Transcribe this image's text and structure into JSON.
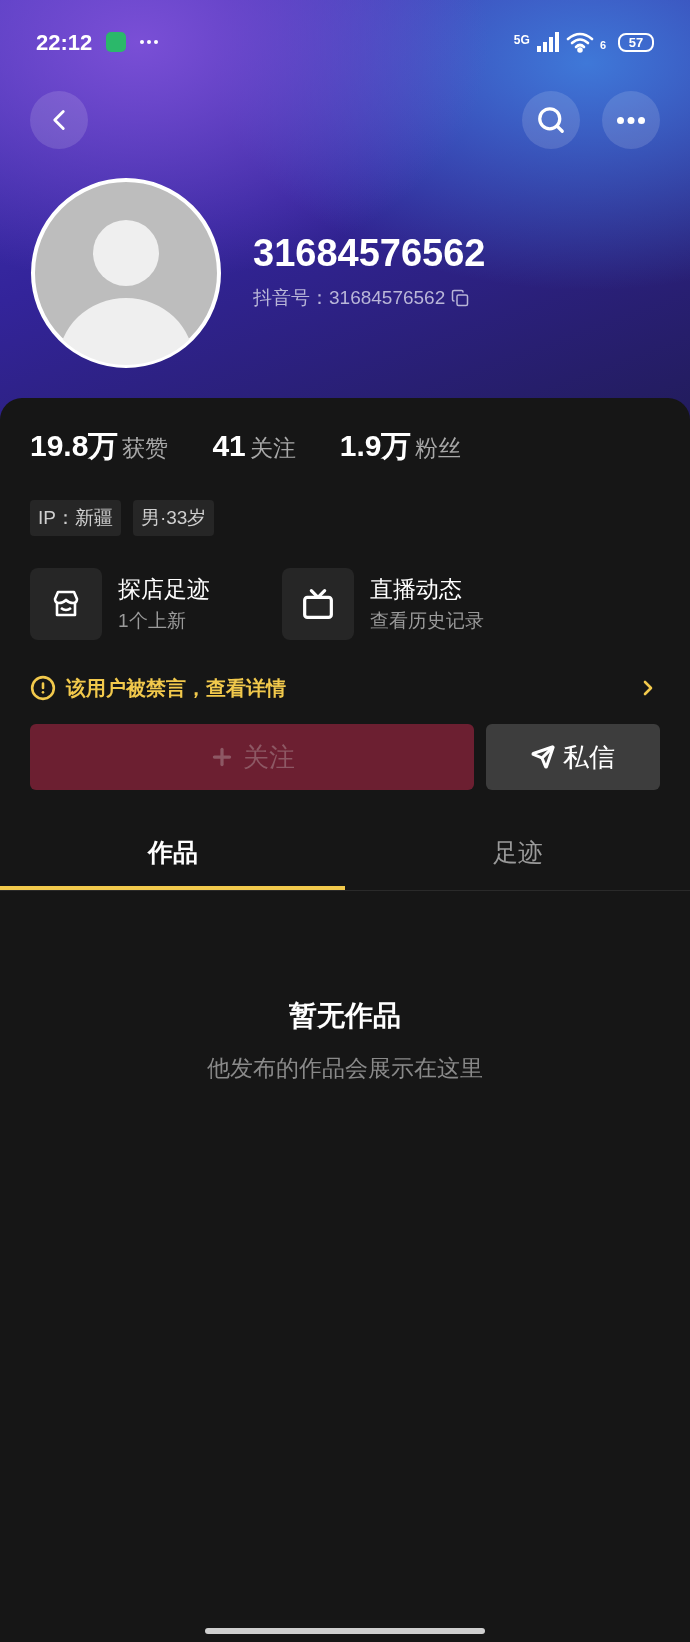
{
  "status_bar": {
    "time": "22:12",
    "network": "5G",
    "wifi_band": "6",
    "battery": "57"
  },
  "profile": {
    "name": "31684576562",
    "account": "抖音号：31684576562"
  },
  "stats": [
    {
      "value": "19.8万",
      "label": "获赞"
    },
    {
      "value": "41",
      "label": "关注"
    },
    {
      "value": "1.9万",
      "label": "粉丝"
    }
  ],
  "tags": [
    "IP：新疆",
    "男·33岁"
  ],
  "shortcuts": [
    {
      "kind": "store",
      "title": "探店足迹",
      "subtitle": "1个上新"
    },
    {
      "kind": "live",
      "title": "直播动态",
      "subtitle": "查看历史记录"
    }
  ],
  "notice": {
    "text": "该用户被禁言，查看详情"
  },
  "actions": [
    {
      "kind": "follow",
      "label": "关注",
      "disabled": true
    },
    {
      "kind": "message",
      "label": "私信",
      "disabled": false
    }
  ],
  "tabs": [
    {
      "label": "作品",
      "selected": true
    },
    {
      "label": "足迹",
      "selected": false
    }
  ],
  "empty": {
    "title": "暂无作品",
    "subtitle": "他发布的作品会展示在这里"
  }
}
